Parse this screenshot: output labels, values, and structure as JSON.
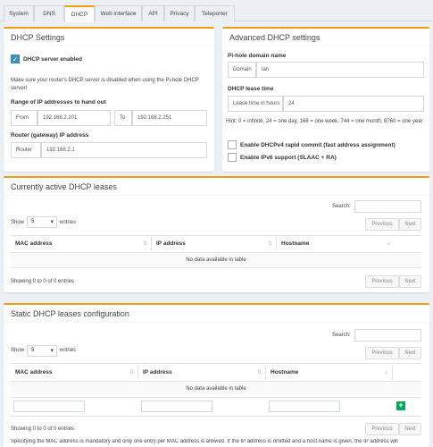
{
  "tabs": [
    "System",
    "DNS",
    "DHCP",
    "Web interface",
    "API",
    "Privacy",
    "Teleporter"
  ],
  "dhcp_settings": {
    "title": "DHCP Settings",
    "server_enabled_label": "DHCP server enabled",
    "help": "Make sure your router's DHCP server is disabled when using the Pi-hole DHCP server!",
    "range_label": "Range of IP addresses to hand out",
    "from_label": "From",
    "from_value": "192.168.2.201",
    "to_label": "To",
    "to_value": "192.168.2.251",
    "router_section_label": "Router (gateway) IP address",
    "router_label": "Router",
    "router_value": "192.168.2.1"
  },
  "advanced": {
    "title": "Advanced DHCP settings",
    "domain_section_label": "Pi-hole domain name",
    "domain_label": "Domain",
    "domain_value": "lan",
    "lease_section_label": "DHCP lease time",
    "lease_label": "Lease time in hours",
    "lease_value": "24",
    "hint": "Hint: 0 = infinite, 24 = one day, 168 = one week, 744 = one month, 8760 = one year",
    "rapid_commit_label": "Enable DHCPv4 rapid commit (fast address assignment)",
    "ipv6_label": "Enable IPv6 support (SLAAC + RA)"
  },
  "active_leases": {
    "title": "Currently active DHCP leases",
    "search_label": "Search:",
    "show_label": "Show",
    "show_value": "5",
    "entries_label": "entries",
    "previous": "Previous",
    "next": "Next",
    "columns": [
      "MAC address",
      "IP address",
      "Hostname"
    ],
    "empty": "No data available in table",
    "info": "Showing 0 to 0 of 0 entries"
  },
  "static_leases": {
    "title": "Static DHCP leases configuration",
    "search_label": "Search:",
    "show_label": "Show",
    "show_value": "5",
    "entries_label": "entries",
    "previous": "Previous",
    "next": "Next",
    "columns": [
      "MAC address",
      "IP address",
      "Hostname"
    ],
    "empty": "No data available in table",
    "add_icon": "+",
    "info": "Showing 0 to 0 of 0 entries",
    "footer_note": "Specifying the MAC address is mandatory and only one entry per MAC address is allowed. If the IP address is omitted and a host name is given, the IP address will"
  },
  "icons": {
    "sort": "sort-icon",
    "sort_alpha": "sort-alpha-icon",
    "check": "check-icon",
    "caret": "caret-down-icon",
    "add": "plus-icon"
  },
  "colors": {
    "accent": "#f39c12",
    "primary": "#3c8dbc",
    "success": "#00a65a",
    "background": "#ecf0f5"
  }
}
